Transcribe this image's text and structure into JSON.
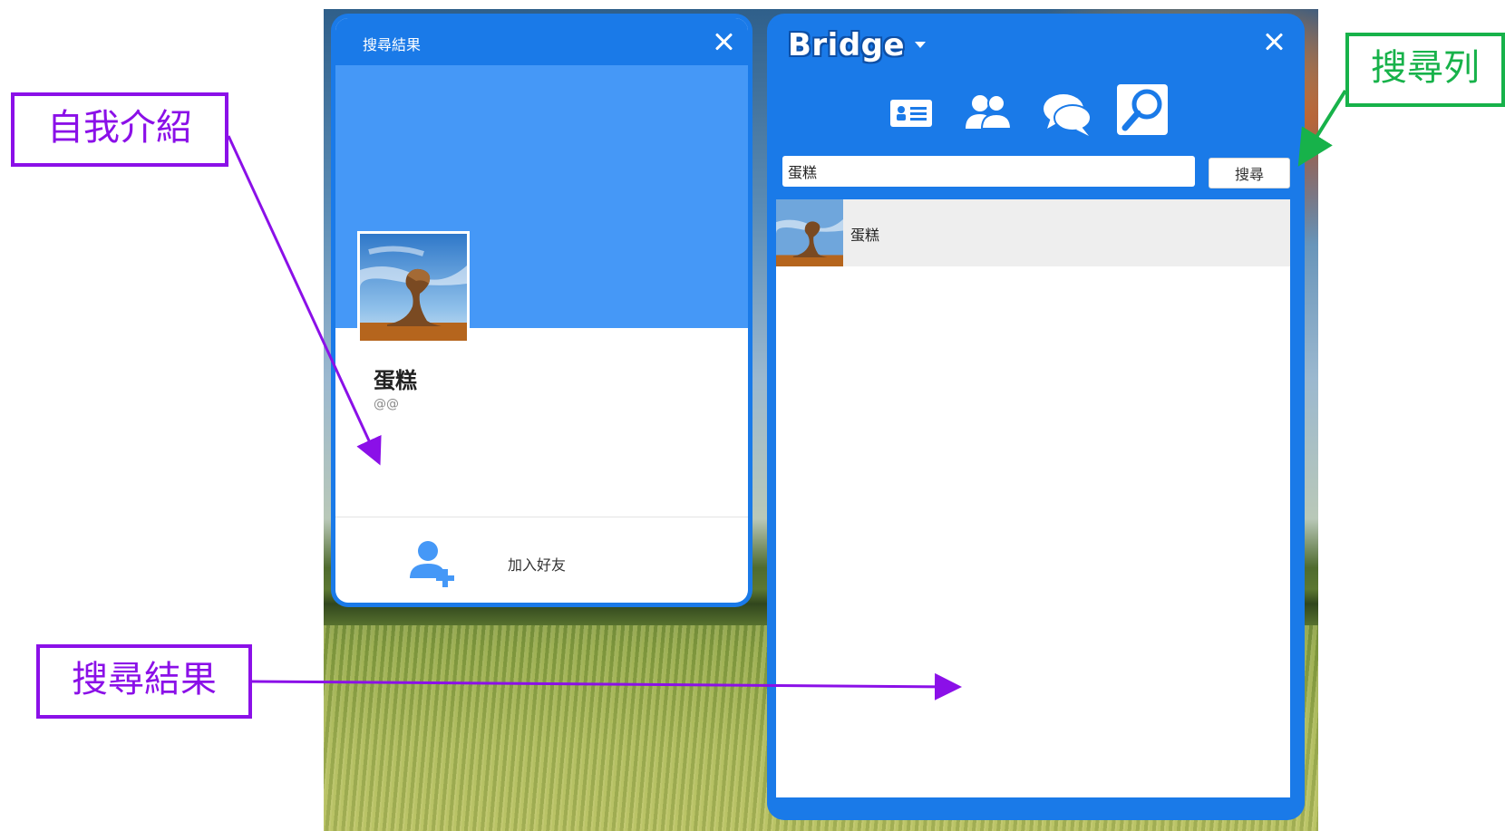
{
  "profile_window": {
    "title": "搜尋結果",
    "name": "蛋糕",
    "handle": "@@",
    "add_friend_label": "加入好友"
  },
  "bridge_window": {
    "app_name": "Bridge",
    "nav_icons": [
      "contact-card-icon",
      "friends-icon",
      "chat-icon",
      "search-icon"
    ],
    "active_nav": "search-icon",
    "search": {
      "value": "蛋糕",
      "button_label": "搜尋"
    },
    "results": [
      {
        "name": "蛋糕"
      }
    ]
  },
  "annotations": {
    "self_intro": "自我介紹",
    "search_results": "搜尋結果",
    "search_bar": "搜尋列"
  },
  "colors": {
    "window_blue": "#1a7ae8",
    "cover_blue": "#4598f7",
    "annotation_purple": "#8b10e8",
    "annotation_green": "#17b24a"
  }
}
